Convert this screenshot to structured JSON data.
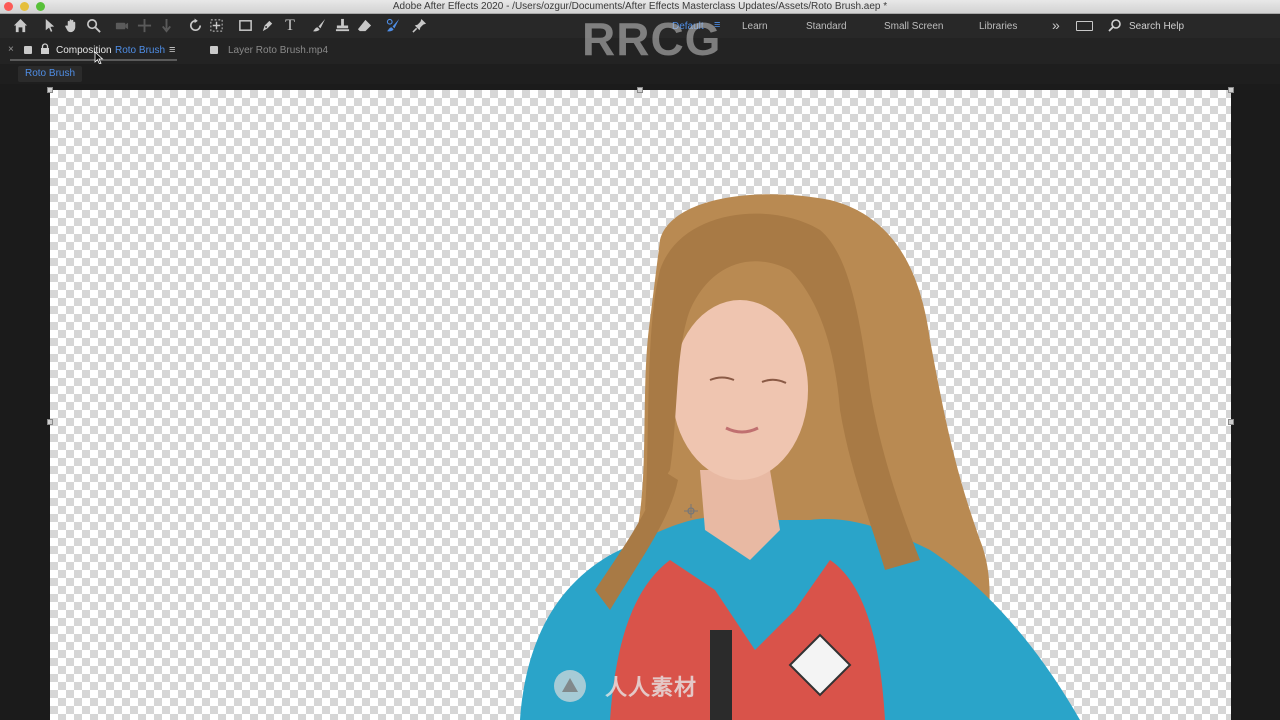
{
  "window": {
    "title": "Adobe After Effects 2020 - /Users/ozgur/Documents/After Effects Masterclass Updates/Assets/Roto Brush.aep *"
  },
  "toolbar": {
    "tools": [
      {
        "icon": "home-icon"
      },
      {
        "icon": "selection-tool-icon"
      },
      {
        "icon": "hand-tool-icon"
      },
      {
        "icon": "zoom-tool-icon"
      },
      {
        "icon": "orbit-camera-icon"
      },
      {
        "icon": "pan-camera-icon"
      },
      {
        "icon": "dolly-camera-icon"
      },
      {
        "icon": "rotate-tool-icon"
      },
      {
        "icon": "pan-behind-tool-icon"
      },
      {
        "icon": "rectangle-tool-icon"
      },
      {
        "icon": "pen-tool-icon"
      },
      {
        "icon": "type-tool-icon"
      },
      {
        "icon": "brush-tool-icon"
      },
      {
        "icon": "clone-stamp-tool-icon"
      },
      {
        "icon": "eraser-tool-icon"
      },
      {
        "icon": "roto-brush-tool-icon"
      },
      {
        "icon": "puppet-pin-tool-icon"
      }
    ],
    "workspaces": [
      "Default",
      "Learn",
      "Standard",
      "Small Screen",
      "Libraries"
    ],
    "active_workspace": "Default",
    "search_label": "Search Help"
  },
  "panel": {
    "tab1_prefix": "Composition",
    "tab1_name": "Roto Brush",
    "tab2_label": "Layer Roto Brush.mp4",
    "subtab_label": "Roto Brush",
    "close_glyph": "×",
    "menu_glyph": "≡"
  },
  "watermarks": {
    "top": "RRCG",
    "bottom": "人人素材"
  },
  "colors": {
    "accent": "#4f8ee6",
    "comp_swatch": "#c9c9c9",
    "layer_swatch": "#c9c9c9"
  }
}
